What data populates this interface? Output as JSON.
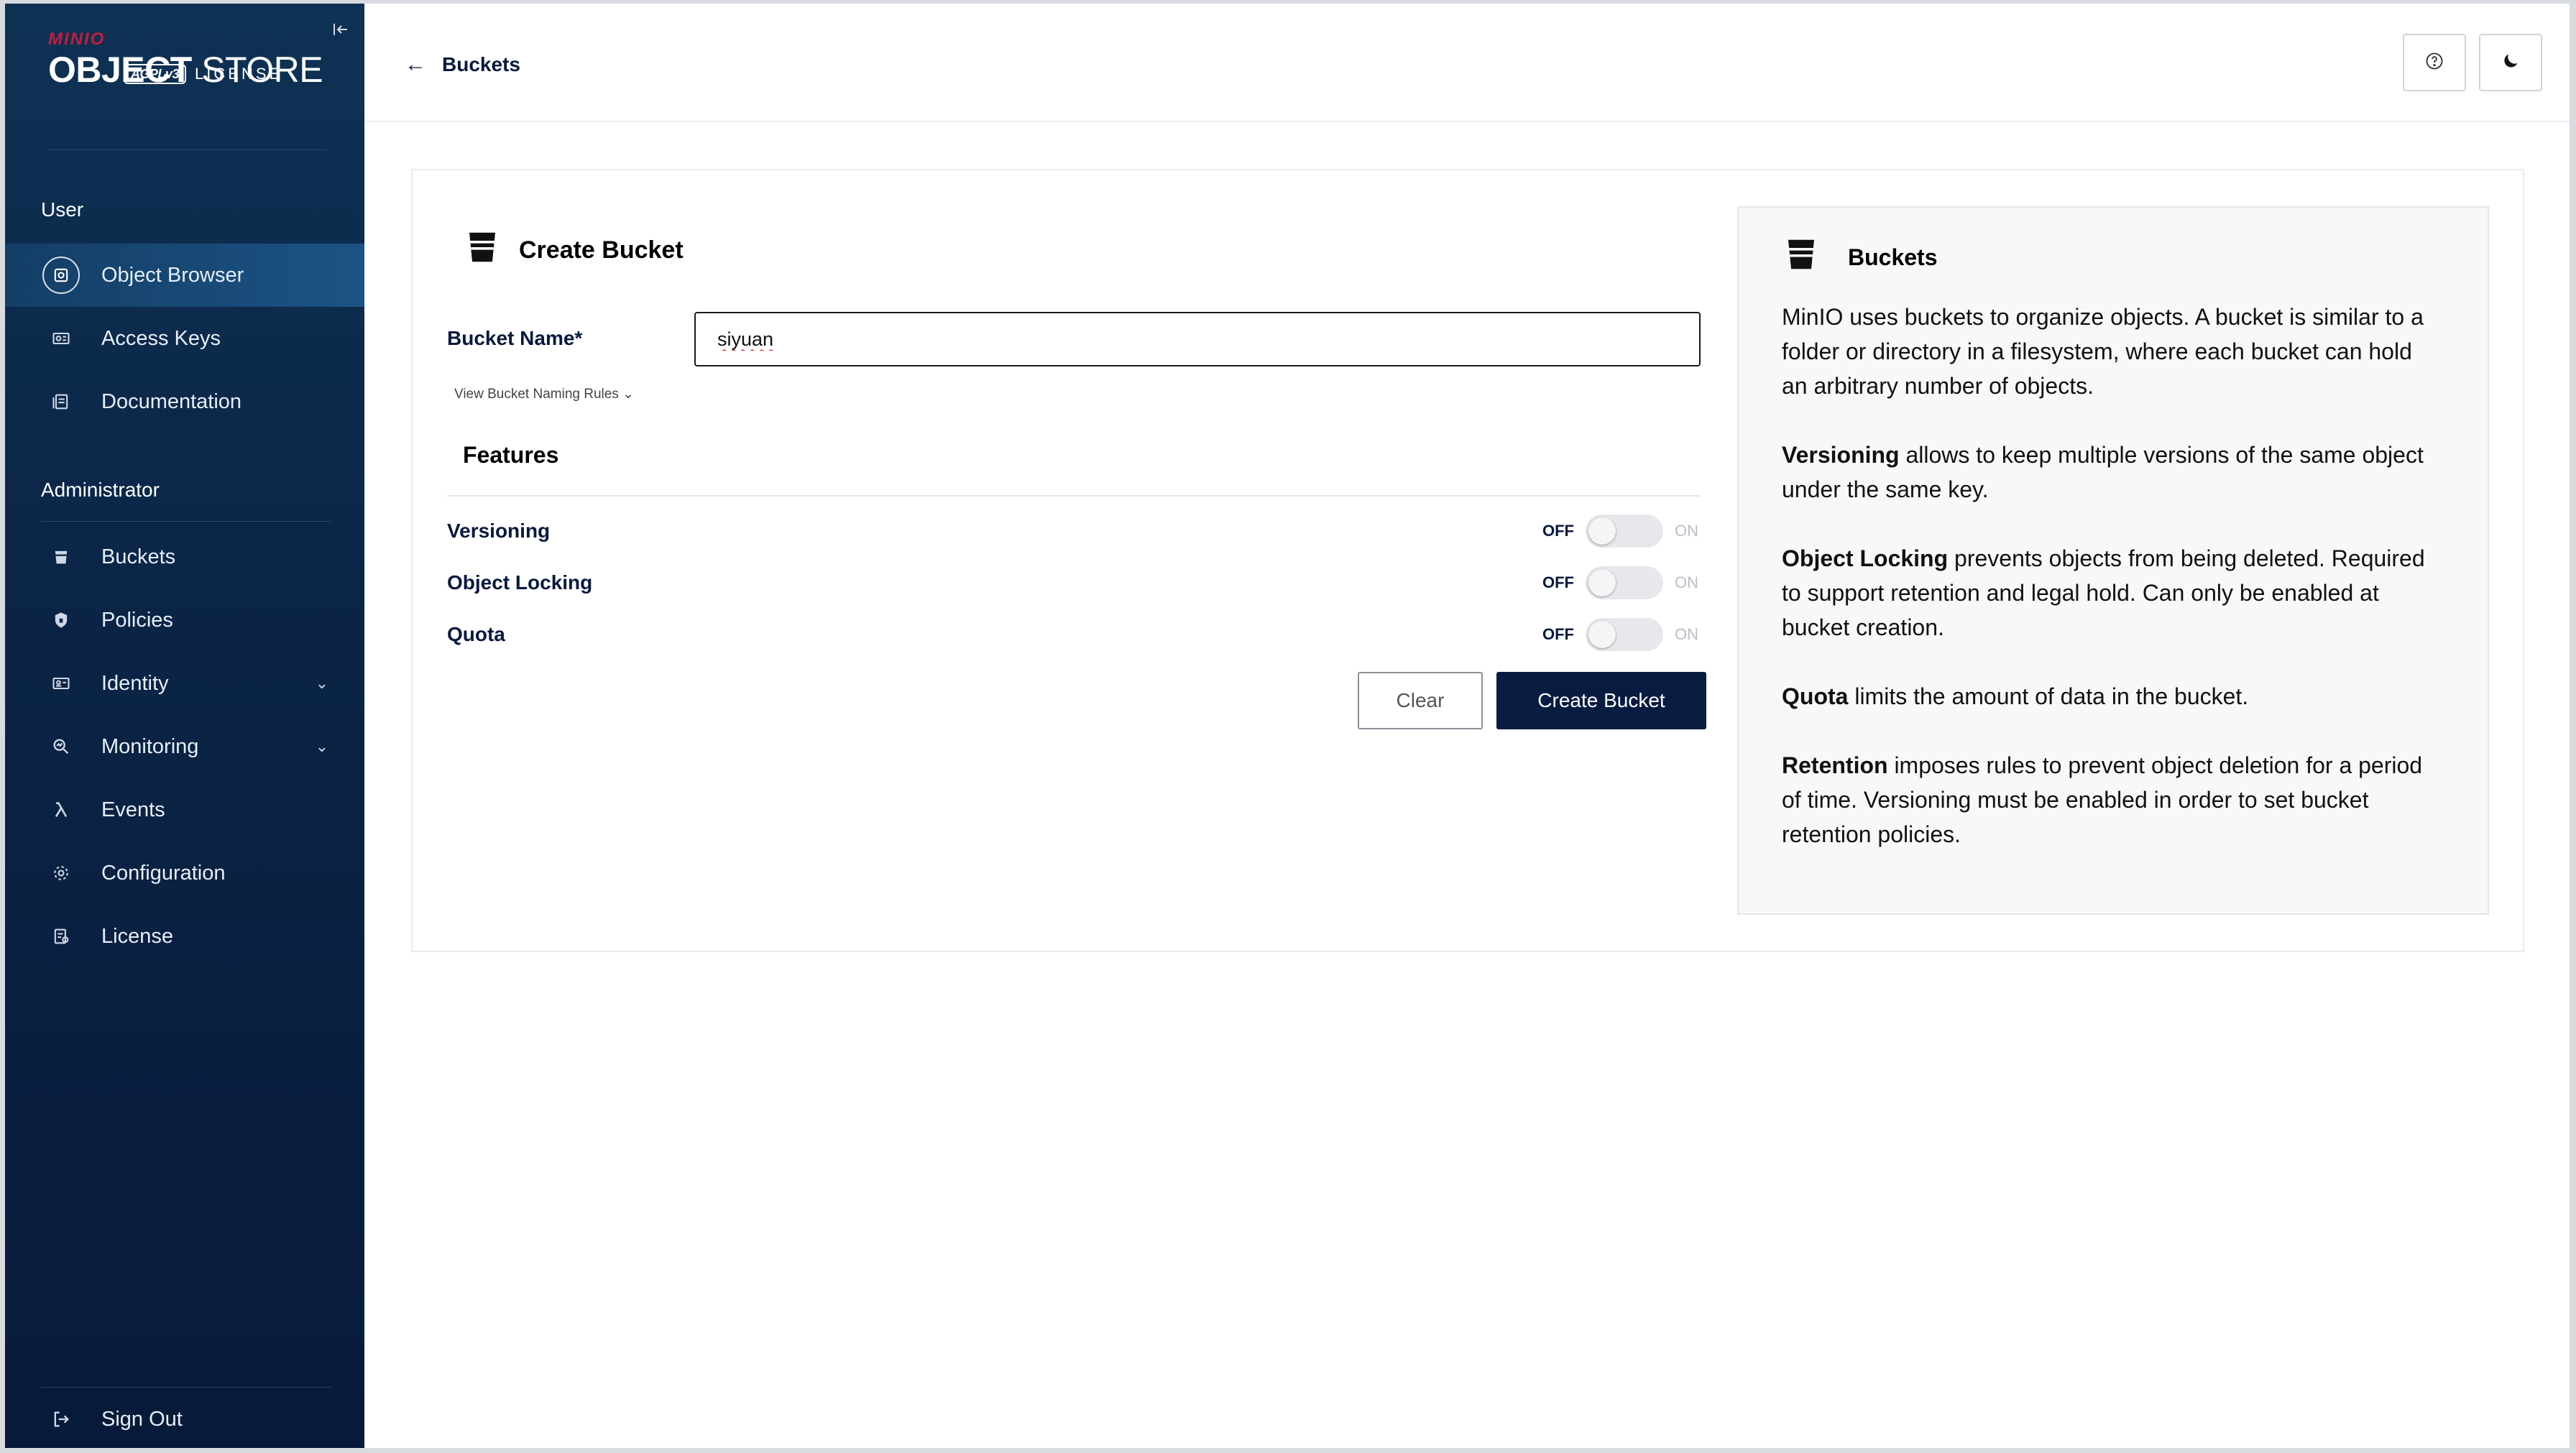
{
  "brand": {
    "minio": "MINIO",
    "title_bold": "OBJECT",
    "title_rest": " STORE",
    "agpl": "AGPLv3",
    "license": "LICENSE"
  },
  "sidebar": {
    "user_section": "User",
    "admin_section": "Administrator",
    "user_items": [
      {
        "label": "Object Browser",
        "icon": "object-browser-icon",
        "active": true
      },
      {
        "label": "Access Keys",
        "icon": "access-keys-icon"
      },
      {
        "label": "Documentation",
        "icon": "documentation-icon"
      }
    ],
    "admin_items": [
      {
        "label": "Buckets",
        "icon": "bucket-icon"
      },
      {
        "label": "Policies",
        "icon": "shield-icon"
      },
      {
        "label": "Identity",
        "icon": "identity-icon",
        "expandable": true
      },
      {
        "label": "Monitoring",
        "icon": "monitoring-icon",
        "expandable": true
      },
      {
        "label": "Events",
        "icon": "lambda-icon"
      },
      {
        "label": "Configuration",
        "icon": "gear-icon"
      },
      {
        "label": "License",
        "icon": "license-icon"
      }
    ],
    "sign_out": "Sign Out"
  },
  "header": {
    "back_label": "Buckets"
  },
  "form": {
    "title": "Create Bucket",
    "bucket_name_label": "Bucket Name*",
    "bucket_name_value": "siyuan",
    "naming_rules_link": "View Bucket Naming Rules",
    "features_title": "Features",
    "features": [
      {
        "label": "Versioning",
        "off": "OFF",
        "on": "ON",
        "enabled": false
      },
      {
        "label": "Object Locking",
        "off": "OFF",
        "on": "ON",
        "enabled": false
      },
      {
        "label": "Quota",
        "off": "OFF",
        "on": "ON",
        "enabled": false
      }
    ],
    "clear_label": "Clear",
    "create_label": "Create Bucket"
  },
  "help": {
    "title": "Buckets",
    "intro": "MinIO uses buckets to organize objects. A bucket is similar to a folder or directory in a filesystem, where each bucket can hold an arbitrary number of objects.",
    "versioning_term": "Versioning",
    "versioning_text": " allows to keep multiple versions of the same object under the same key.",
    "locking_term": "Object Locking",
    "locking_text": " prevents objects from being deleted. Required to support retention and legal hold. Can only be enabled at bucket creation.",
    "quota_term": "Quota",
    "quota_text": " limits the amount of data in the bucket.",
    "retention_term": "Retention",
    "retention_text": " imposes rules to prevent object deletion for a period of time. Versioning must be enabled in order to set bucket retention policies."
  },
  "colors": {
    "sidebar_top": "#0e3254",
    "sidebar_bottom": "#081a3a",
    "primary_button": "#081c42",
    "text_dark": "#07193e"
  }
}
